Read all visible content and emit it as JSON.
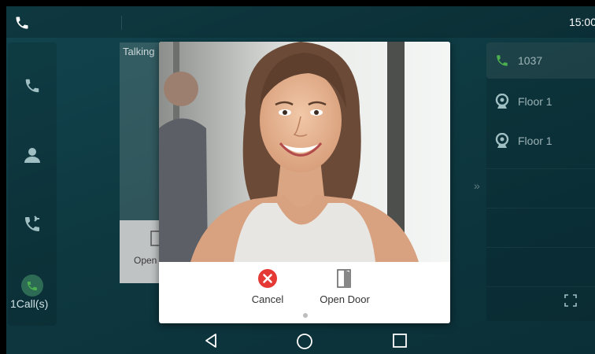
{
  "status_bar": {
    "time": "15:00"
  },
  "sidebar": {
    "call_count": "1Call(s)"
  },
  "call_card": {
    "state": "Talking",
    "open_label": "Open"
  },
  "right_panel": {
    "lines": [
      {
        "label": "1037",
        "icon": "phone-icon"
      },
      {
        "label": "Floor 1",
        "icon": "webcam-icon"
      },
      {
        "label": "Floor 1",
        "icon": "webcam-icon"
      }
    ]
  },
  "popup": {
    "cancel_label": "Cancel",
    "open_door_label": "Open Door"
  },
  "colors": {
    "accent_green": "#4caf50",
    "cancel_red": "#e53935",
    "background": "#0e3941"
  }
}
